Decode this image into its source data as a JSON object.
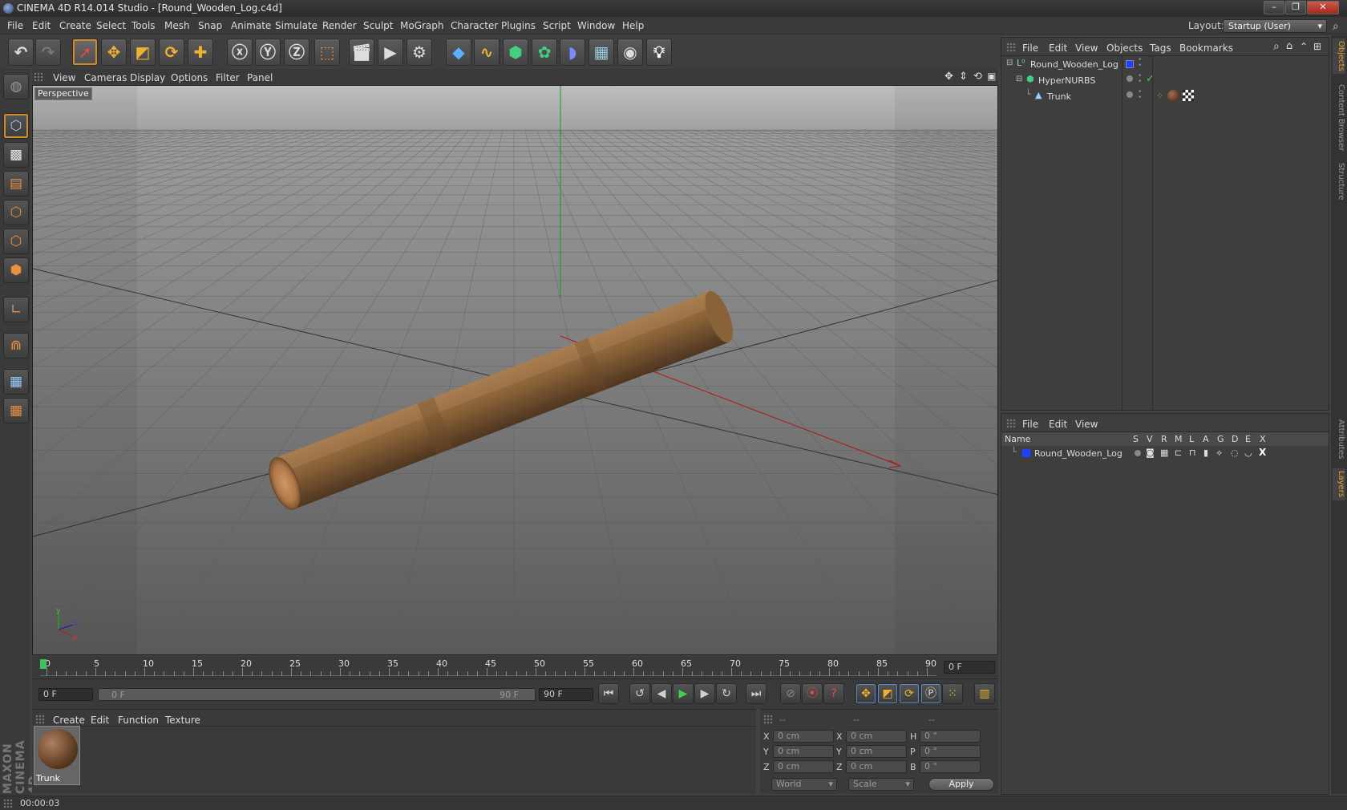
{
  "window": {
    "title": "CINEMA 4D R14.014 Studio - [Round_Wooden_Log.c4d]",
    "minimize": "–",
    "maximize": "❐",
    "close": "✕"
  },
  "menubar": [
    "File",
    "Edit",
    "Create",
    "Select",
    "Tools",
    "Mesh",
    "Snap",
    "Animate",
    "Simulate",
    "Render",
    "Sculpt",
    "MoGraph",
    "Character",
    "Plugins",
    "Script",
    "Window",
    "Help"
  ],
  "layout": {
    "label": "Layout:",
    "value": "Startup (User)"
  },
  "viewport": {
    "menu": [
      "View",
      "Cameras",
      "Display",
      "Options",
      "Filter",
      "Panel"
    ],
    "label": "Perspective",
    "axis_labels": {
      "y": "y",
      "z": "z",
      "x": "x"
    }
  },
  "timeline": {
    "ticks": [
      "0",
      "5",
      "10",
      "15",
      "20",
      "25",
      "30",
      "35",
      "40",
      "45",
      "50",
      "55",
      "60",
      "65",
      "70",
      "75",
      "80",
      "85",
      "90"
    ],
    "current_frame": "0 F",
    "start_field": "0 F",
    "range_start": "0 F",
    "range_end": "90 F",
    "end_field": "90 F"
  },
  "material_panel": {
    "menu": [
      "Create",
      "Edit",
      "Function",
      "Texture"
    ],
    "materials": [
      {
        "name": "Trunk"
      }
    ]
  },
  "coord_panel": {
    "headers": [
      "--",
      "--",
      "--"
    ],
    "rows": [
      {
        "l1": "X",
        "v1": "0 cm",
        "l2": "X",
        "v2": "0 cm",
        "l3": "H",
        "v3": "0 °"
      },
      {
        "l1": "Y",
        "v1": "0 cm",
        "l2": "Y",
        "v2": "0 cm",
        "l3": "P",
        "v3": "0 °"
      },
      {
        "l1": "Z",
        "v1": "0 cm",
        "l2": "Z",
        "v2": "0 cm",
        "l3": "B",
        "v3": "0 °"
      }
    ],
    "world": "World",
    "scale": "Scale",
    "apply": "Apply"
  },
  "status": {
    "time": "00:00:03"
  },
  "object_manager": {
    "menu": [
      "File",
      "Edit",
      "View",
      "Objects",
      "Tags",
      "Bookmarks"
    ],
    "objects": [
      {
        "name": "Round_Wooden_Log"
      },
      {
        "name": "HyperNURBS"
      },
      {
        "name": "Trunk"
      }
    ]
  },
  "layer_manager": {
    "menu": [
      "File",
      "Edit",
      "View"
    ],
    "columns": [
      "Name",
      "S",
      "V",
      "R",
      "M",
      "L",
      "A",
      "G",
      "D",
      "E",
      "X"
    ],
    "layers": [
      {
        "name": "Round_Wooden_Log"
      }
    ]
  },
  "side_tabs": [
    "Objects",
    "Content Browser",
    "Structure",
    "Attributes",
    "Layers"
  ],
  "colors": {
    "accent": "#e8a030",
    "x_axis": "#c02020",
    "y_axis": "#20a020",
    "layer_color": "#2040ff"
  }
}
